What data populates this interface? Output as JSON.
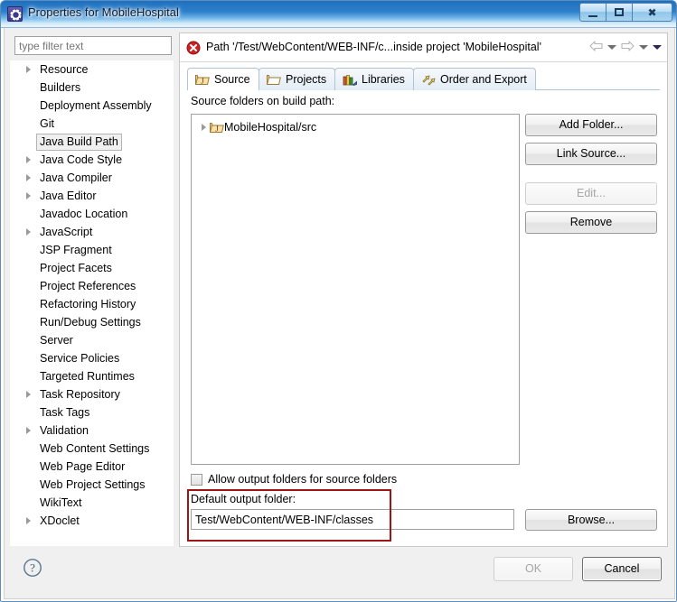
{
  "window": {
    "title": "Properties for MobileHospital",
    "icon": "gear-icon",
    "minimize_label": "Minimize",
    "maximize_label": "Maximize",
    "close_label": "Close"
  },
  "sidebar": {
    "filter": {
      "placeholder": "type filter text",
      "value": ""
    },
    "items": [
      {
        "label": "Resource",
        "expandable": true,
        "selected": false
      },
      {
        "label": "Builders",
        "expandable": false,
        "selected": false
      },
      {
        "label": "Deployment Assembly",
        "expandable": false,
        "selected": false
      },
      {
        "label": "Git",
        "expandable": false,
        "selected": false
      },
      {
        "label": "Java Build Path",
        "expandable": false,
        "selected": true
      },
      {
        "label": "Java Code Style",
        "expandable": true,
        "selected": false
      },
      {
        "label": "Java Compiler",
        "expandable": true,
        "selected": false
      },
      {
        "label": "Java Editor",
        "expandable": true,
        "selected": false
      },
      {
        "label": "Javadoc Location",
        "expandable": false,
        "selected": false
      },
      {
        "label": "JavaScript",
        "expandable": true,
        "selected": false
      },
      {
        "label": "JSP Fragment",
        "expandable": false,
        "selected": false
      },
      {
        "label": "Project Facets",
        "expandable": false,
        "selected": false
      },
      {
        "label": "Project References",
        "expandable": false,
        "selected": false
      },
      {
        "label": "Refactoring History",
        "expandable": false,
        "selected": false
      },
      {
        "label": "Run/Debug Settings",
        "expandable": false,
        "selected": false
      },
      {
        "label": "Server",
        "expandable": false,
        "selected": false
      },
      {
        "label": "Service Policies",
        "expandable": false,
        "selected": false
      },
      {
        "label": "Targeted Runtimes",
        "expandable": false,
        "selected": false
      },
      {
        "label": "Task Repository",
        "expandable": true,
        "selected": false
      },
      {
        "label": "Task Tags",
        "expandable": false,
        "selected": false
      },
      {
        "label": "Validation",
        "expandable": true,
        "selected": false
      },
      {
        "label": "Web Content Settings",
        "expandable": false,
        "selected": false
      },
      {
        "label": "Web Page Editor",
        "expandable": false,
        "selected": false
      },
      {
        "label": "Web Project Settings",
        "expandable": false,
        "selected": false
      },
      {
        "label": "WikiText",
        "expandable": false,
        "selected": false
      },
      {
        "label": "XDoclet",
        "expandable": true,
        "selected": false
      }
    ]
  },
  "message": {
    "icon": "error-icon",
    "text": "Path '/Test/WebContent/WEB-INF/c...inside project 'MobileHospital'",
    "nav": {
      "back_icon": "arrow-left-icon",
      "back_menu_icon": "chevron-down-icon",
      "forward_icon": "arrow-right-icon",
      "forward_menu_icon": "chevron-down-icon",
      "menu_icon": "chevron-down-icon"
    }
  },
  "tabs": [
    {
      "label": "Source",
      "icon": "source-folder-icon",
      "active": true
    },
    {
      "label": "Projects",
      "icon": "projects-folder-icon",
      "active": false
    },
    {
      "label": "Libraries",
      "icon": "libraries-icon",
      "active": false
    },
    {
      "label": "Order and Export",
      "icon": "order-export-icon",
      "active": false
    }
  ],
  "source_tab": {
    "list_label": "Source folders on build path:",
    "entries": [
      {
        "label": "MobileHospital/src",
        "icon": "source-folder-icon",
        "expandable": true
      }
    ],
    "buttons": [
      {
        "label": "Add Folder...",
        "disabled": false,
        "name": "add-folder-button"
      },
      {
        "label": "Link Source...",
        "disabled": false,
        "name": "link-source-button"
      },
      {
        "label": "Edit...",
        "disabled": true,
        "name": "edit-button"
      },
      {
        "label": "Remove",
        "disabled": false,
        "name": "remove-button"
      }
    ],
    "allow_output_checkbox": {
      "label": "Allow output folders for source folders",
      "checked": false
    },
    "default_output": {
      "label": "Default output folder:",
      "value": "Test/WebContent/WEB-INF/classes",
      "browse_label": "Browse..."
    }
  },
  "footer": {
    "help_icon": "help-icon",
    "ok_label": "OK",
    "ok_disabled": true,
    "cancel_label": "Cancel"
  },
  "colors": {
    "titlebar_blue": "#2d80cb",
    "error_red": "#cc2222",
    "annotation_red": "#9c1616",
    "dialog_bg": "#f0f0f0",
    "tab_border": "#b0c4d8"
  }
}
